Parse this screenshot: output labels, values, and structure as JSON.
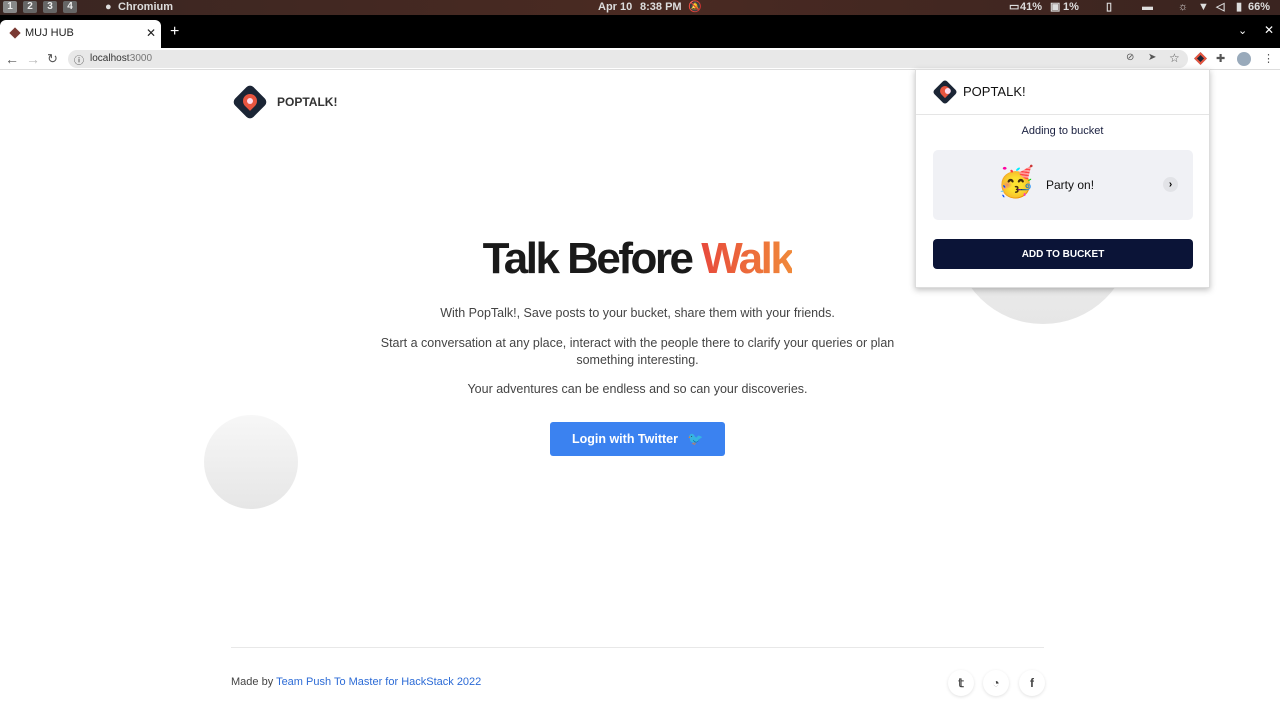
{
  "system_bar": {
    "workspaces": [
      "1",
      "2",
      "3",
      "4"
    ],
    "app": "Chromium",
    "date": "Apr 10",
    "time": "8:38 PM",
    "cpu": "41%",
    "disk": "1%",
    "battery": "66%"
  },
  "browser": {
    "tab_title": "MUJ HUB",
    "url_host": "localhost",
    "url_port": ":3000"
  },
  "page": {
    "brand": "POPTALK!",
    "title_main": "Talk Before ",
    "title_accent": "Walk",
    "accent_colors": [
      "#e84a3c",
      "#f0893a"
    ],
    "paragraphs": [
      "With PopTalk!, Save posts to your bucket, share them with your friends.",
      "Start a conversation at any place, interact with the people there to clarify your queries or plan something interesting.",
      "Your adventures can be endless and so can your discoveries."
    ],
    "login_label": "Login with Twitter",
    "footer_prefix": "Made by ",
    "footer_link": "Team Push To Master for HackStack 2022"
  },
  "popup": {
    "brand": "POPTALK!",
    "subtitle": "Adding to bucket",
    "item_emoji": "🥳",
    "item_label": "Party on!",
    "button": "ADD TO BUCKET",
    "button_color": "#0b1437"
  }
}
